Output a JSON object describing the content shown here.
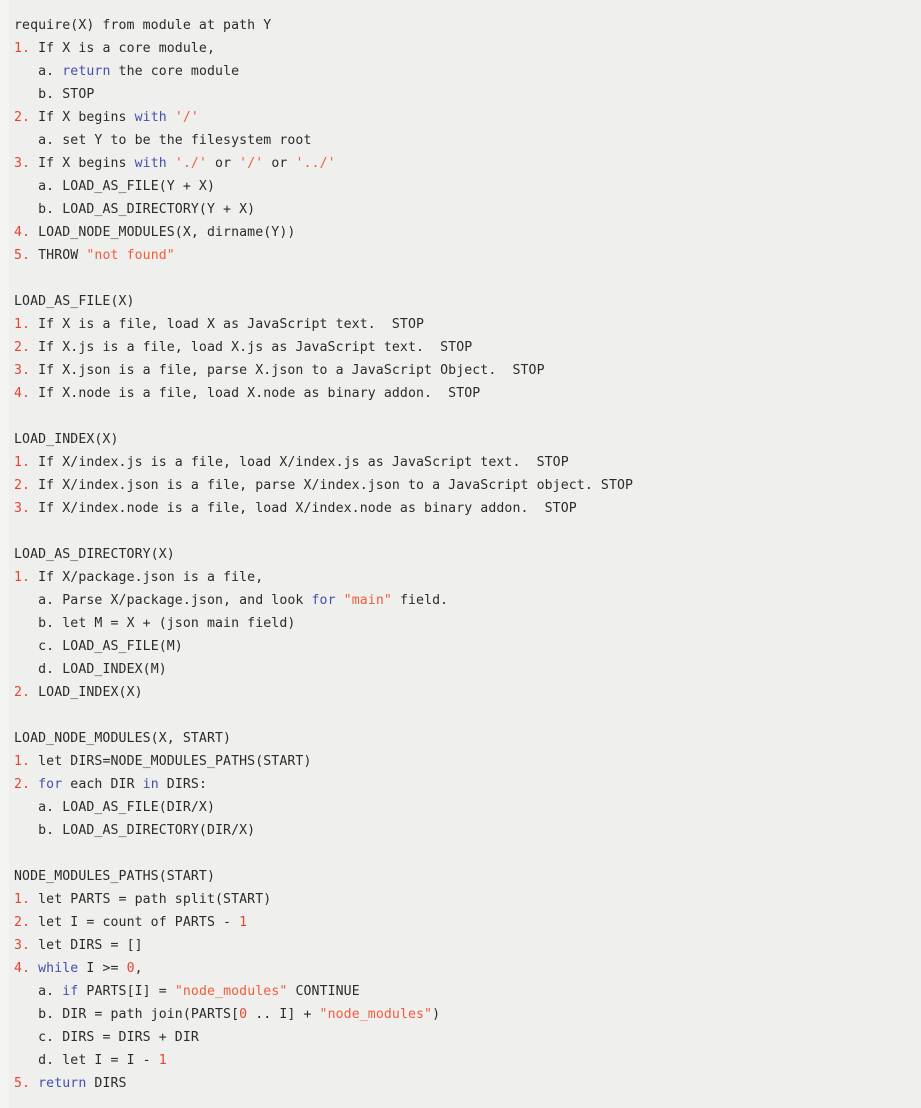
{
  "document": {
    "title": "Node.js require() module resolution pseudocode",
    "background_color": "#efefed",
    "text_color": "#2b2b2b",
    "number_color": "#e8432e",
    "keyword_color": "#4450b0",
    "string_color": "#f25c3b"
  },
  "blocks": [
    {
      "heading": "require(X) from module at path Y",
      "lines": [
        {
          "marker": "1.",
          "indent": 0,
          "tokens": [
            {
              "t": " If X is a core module,",
              "c": "plain"
            }
          ]
        },
        {
          "marker": "a.",
          "indent": 1,
          "tokens": [
            {
              "t": " ",
              "c": "plain"
            },
            {
              "t": "return",
              "c": "kw"
            },
            {
              "t": " the core module",
              "c": "plain"
            }
          ]
        },
        {
          "marker": "b.",
          "indent": 1,
          "tokens": [
            {
              "t": " STOP",
              "c": "plain"
            }
          ]
        },
        {
          "marker": "2.",
          "indent": 0,
          "tokens": [
            {
              "t": " If X begins ",
              "c": "plain"
            },
            {
              "t": "with",
              "c": "kw"
            },
            {
              "t": " ",
              "c": "plain"
            },
            {
              "t": "'/'",
              "c": "str"
            }
          ]
        },
        {
          "marker": "a.",
          "indent": 1,
          "tokens": [
            {
              "t": " set Y to be the filesystem root",
              "c": "plain"
            }
          ]
        },
        {
          "marker": "3.",
          "indent": 0,
          "tokens": [
            {
              "t": " If X begins ",
              "c": "plain"
            },
            {
              "t": "with",
              "c": "kw"
            },
            {
              "t": " ",
              "c": "plain"
            },
            {
              "t": "'./'",
              "c": "str"
            },
            {
              "t": " or ",
              "c": "plain"
            },
            {
              "t": "'/'",
              "c": "str"
            },
            {
              "t": " or ",
              "c": "plain"
            },
            {
              "t": "'../'",
              "c": "str"
            }
          ]
        },
        {
          "marker": "a.",
          "indent": 1,
          "tokens": [
            {
              "t": " LOAD_AS_FILE(Y + X)",
              "c": "plain"
            }
          ]
        },
        {
          "marker": "b.",
          "indent": 1,
          "tokens": [
            {
              "t": " LOAD_AS_DIRECTORY(Y + X)",
              "c": "plain"
            }
          ]
        },
        {
          "marker": "4.",
          "indent": 0,
          "tokens": [
            {
              "t": " LOAD_NODE_MODULES(X, dirname(Y))",
              "c": "plain"
            }
          ]
        },
        {
          "marker": "5.",
          "indent": 0,
          "tokens": [
            {
              "t": " THROW ",
              "c": "plain"
            },
            {
              "t": "\"not found\"",
              "c": "str"
            }
          ]
        }
      ]
    },
    {
      "heading": "LOAD_AS_FILE(X)",
      "lines": [
        {
          "marker": "1.",
          "indent": 0,
          "tokens": [
            {
              "t": " If X is a file, load X as JavaScript text.  STOP",
              "c": "plain"
            }
          ]
        },
        {
          "marker": "2.",
          "indent": 0,
          "tokens": [
            {
              "t": " If X.js is a file, load X.js as JavaScript text.  STOP",
              "c": "plain"
            }
          ]
        },
        {
          "marker": "3.",
          "indent": 0,
          "tokens": [
            {
              "t": " If X.json is a file, parse X.json to a JavaScript Object.  STOP",
              "c": "plain"
            }
          ]
        },
        {
          "marker": "4.",
          "indent": 0,
          "tokens": [
            {
              "t": " If X.node is a file, load X.node as binary addon.  STOP",
              "c": "plain"
            }
          ]
        }
      ]
    },
    {
      "heading": "LOAD_INDEX(X)",
      "lines": [
        {
          "marker": "1.",
          "indent": 0,
          "tokens": [
            {
              "t": " If X/index.js is a file, load X/index.js as JavaScript text.  STOP",
              "c": "plain"
            }
          ]
        },
        {
          "marker": "2.",
          "indent": 0,
          "tokens": [
            {
              "t": " If X/index.json is a file, parse X/index.json to a JavaScript object. STOP",
              "c": "plain"
            }
          ]
        },
        {
          "marker": "3.",
          "indent": 0,
          "tokens": [
            {
              "t": " If X/index.node is a file, load X/index.node as binary addon.  STOP",
              "c": "plain"
            }
          ]
        }
      ]
    },
    {
      "heading": "LOAD_AS_DIRECTORY(X)",
      "lines": [
        {
          "marker": "1.",
          "indent": 0,
          "tokens": [
            {
              "t": " If X/package.json is a file,",
              "c": "plain"
            }
          ]
        },
        {
          "marker": "a.",
          "indent": 1,
          "tokens": [
            {
              "t": " Parse X/package.json, and look ",
              "c": "plain"
            },
            {
              "t": "for",
              "c": "kw"
            },
            {
              "t": " ",
              "c": "plain"
            },
            {
              "t": "\"main\"",
              "c": "str"
            },
            {
              "t": " field.",
              "c": "plain"
            }
          ]
        },
        {
          "marker": "b.",
          "indent": 1,
          "tokens": [
            {
              "t": " let M = X + (json main field)",
              "c": "plain"
            }
          ]
        },
        {
          "marker": "c.",
          "indent": 1,
          "tokens": [
            {
              "t": " LOAD_AS_FILE(M)",
              "c": "plain"
            }
          ]
        },
        {
          "marker": "d.",
          "indent": 1,
          "tokens": [
            {
              "t": " LOAD_INDEX(M)",
              "c": "plain"
            }
          ]
        },
        {
          "marker": "2.",
          "indent": 0,
          "tokens": [
            {
              "t": " LOAD_INDEX(X)",
              "c": "plain"
            }
          ]
        }
      ]
    },
    {
      "heading": "LOAD_NODE_MODULES(X, START)",
      "lines": [
        {
          "marker": "1.",
          "indent": 0,
          "tokens": [
            {
              "t": " let DIRS=NODE_MODULES_PATHS(START)",
              "c": "plain"
            }
          ]
        },
        {
          "marker": "2.",
          "indent": 0,
          "tokens": [
            {
              "t": " ",
              "c": "plain"
            },
            {
              "t": "for",
              "c": "kw"
            },
            {
              "t": " each DIR ",
              "c": "plain"
            },
            {
              "t": "in",
              "c": "kw"
            },
            {
              "t": " DIRS:",
              "c": "plain"
            }
          ]
        },
        {
          "marker": "a.",
          "indent": 1,
          "tokens": [
            {
              "t": " LOAD_AS_FILE(DIR/X)",
              "c": "plain"
            }
          ]
        },
        {
          "marker": "b.",
          "indent": 1,
          "tokens": [
            {
              "t": " LOAD_AS_DIRECTORY(DIR/X)",
              "c": "plain"
            }
          ]
        }
      ]
    },
    {
      "heading": "NODE_MODULES_PATHS(START)",
      "lines": [
        {
          "marker": "1.",
          "indent": 0,
          "tokens": [
            {
              "t": " let PARTS = path split(START)",
              "c": "plain"
            }
          ]
        },
        {
          "marker": "2.",
          "indent": 0,
          "tokens": [
            {
              "t": " let I = count of PARTS - ",
              "c": "plain"
            },
            {
              "t": "1",
              "c": "num"
            }
          ]
        },
        {
          "marker": "3.",
          "indent": 0,
          "tokens": [
            {
              "t": " let DIRS = []",
              "c": "plain"
            }
          ]
        },
        {
          "marker": "4.",
          "indent": 0,
          "tokens": [
            {
              "t": " ",
              "c": "plain"
            },
            {
              "t": "while",
              "c": "kw"
            },
            {
              "t": " I >= ",
              "c": "plain"
            },
            {
              "t": "0",
              "c": "num"
            },
            {
              "t": ",",
              "c": "plain"
            }
          ]
        },
        {
          "marker": "a.",
          "indent": 1,
          "tokens": [
            {
              "t": " ",
              "c": "plain"
            },
            {
              "t": "if",
              "c": "kw"
            },
            {
              "t": " PARTS[I] = ",
              "c": "plain"
            },
            {
              "t": "\"node_modules\"",
              "c": "str"
            },
            {
              "t": " CONTINUE",
              "c": "plain"
            }
          ]
        },
        {
          "marker": "b.",
          "indent": 1,
          "tokens": [
            {
              "t": " DIR = path join(PARTS[",
              "c": "plain"
            },
            {
              "t": "0",
              "c": "num"
            },
            {
              "t": " .. I] + ",
              "c": "plain"
            },
            {
              "t": "\"node_modules\"",
              "c": "str"
            },
            {
              "t": ")",
              "c": "plain"
            }
          ]
        },
        {
          "marker": "c.",
          "indent": 1,
          "tokens": [
            {
              "t": " DIRS = DIRS + DIR",
              "c": "plain"
            }
          ]
        },
        {
          "marker": "d.",
          "indent": 1,
          "tokens": [
            {
              "t": " let I = I - ",
              "c": "plain"
            },
            {
              "t": "1",
              "c": "num"
            }
          ]
        },
        {
          "marker": "5.",
          "indent": 0,
          "tokens": [
            {
              "t": " ",
              "c": "plain"
            },
            {
              "t": "return",
              "c": "kw"
            },
            {
              "t": " DIRS",
              "c": "plain"
            }
          ]
        }
      ]
    }
  ]
}
